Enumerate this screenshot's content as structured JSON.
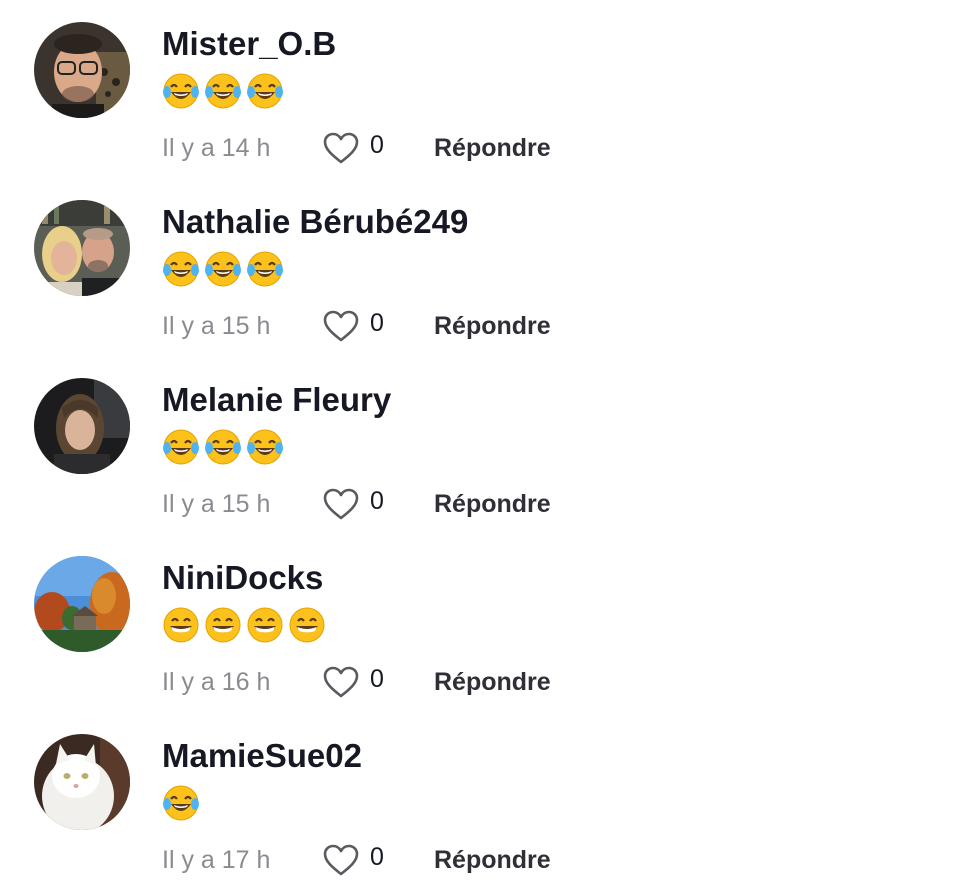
{
  "comments": [
    {
      "username": "Mister_O.B",
      "emojis": [
        "joy",
        "joy",
        "joy"
      ],
      "time": "Il y a 14 h",
      "likes": "0",
      "reply_label": "Répondre",
      "avatar": "man-with-glasses"
    },
    {
      "username": "Nathalie Bérubé249",
      "emojis": [
        "joy",
        "joy",
        "joy"
      ],
      "time": "Il y a 15 h",
      "likes": "0",
      "reply_label": "Répondre",
      "avatar": "couple-selfie"
    },
    {
      "username": "Melanie Fleury",
      "emojis": [
        "joy",
        "joy",
        "joy"
      ],
      "time": "Il y a 15 h",
      "likes": "0",
      "reply_label": "Répondre",
      "avatar": "woman-in-car"
    },
    {
      "username": "NiniDocks",
      "emojis": [
        "grin",
        "grin",
        "grin",
        "grin"
      ],
      "time": "Il y a 16 h",
      "likes": "0",
      "reply_label": "Répondre",
      "avatar": "autumn-landscape"
    },
    {
      "username": "MamieSue02",
      "emojis": [
        "joy"
      ],
      "time": "Il y a 17 h",
      "likes": "0",
      "reply_label": "Répondre",
      "avatar": "white-cat"
    }
  ],
  "colors": {
    "username": "#161823",
    "time": "#8a8b91",
    "reply": "#2f3037",
    "heart_outline": "#5a5b61",
    "emoji_face": "#fcc21b"
  }
}
